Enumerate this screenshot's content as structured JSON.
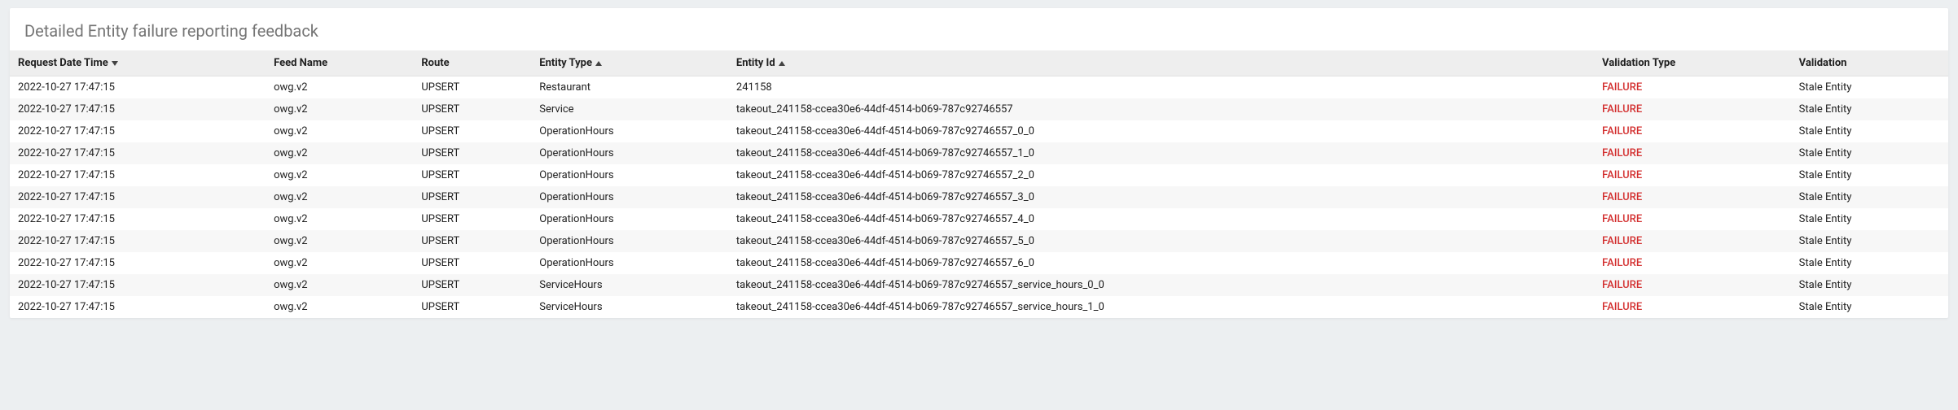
{
  "panel": {
    "title": "Detailed Entity failure reporting feedback"
  },
  "table": {
    "headers": {
      "request_dt": "Request Date Time",
      "feed_name": "Feed Name",
      "route": "Route",
      "entity_type": "Entity Type",
      "entity_id": "Entity Id",
      "validation_type": "Validation Type",
      "validation": "Validation"
    },
    "rows": [
      {
        "dt": "2022-10-27 17:47:15",
        "feed": "owg.v2",
        "route": "UPSERT",
        "etype": "Restaurant",
        "eid": "241158",
        "vtype": "FAILURE",
        "val": "Stale Entity"
      },
      {
        "dt": "2022-10-27 17:47:15",
        "feed": "owg.v2",
        "route": "UPSERT",
        "etype": "Service",
        "eid": "takeout_241158-ccea30e6-44df-4514-b069-787c92746557",
        "vtype": "FAILURE",
        "val": "Stale Entity"
      },
      {
        "dt": "2022-10-27 17:47:15",
        "feed": "owg.v2",
        "route": "UPSERT",
        "etype": "OperationHours",
        "eid": "takeout_241158-ccea30e6-44df-4514-b069-787c92746557_0_0",
        "vtype": "FAILURE",
        "val": "Stale Entity"
      },
      {
        "dt": "2022-10-27 17:47:15",
        "feed": "owg.v2",
        "route": "UPSERT",
        "etype": "OperationHours",
        "eid": "takeout_241158-ccea30e6-44df-4514-b069-787c92746557_1_0",
        "vtype": "FAILURE",
        "val": "Stale Entity"
      },
      {
        "dt": "2022-10-27 17:47:15",
        "feed": "owg.v2",
        "route": "UPSERT",
        "etype": "OperationHours",
        "eid": "takeout_241158-ccea30e6-44df-4514-b069-787c92746557_2_0",
        "vtype": "FAILURE",
        "val": "Stale Entity"
      },
      {
        "dt": "2022-10-27 17:47:15",
        "feed": "owg.v2",
        "route": "UPSERT",
        "etype": "OperationHours",
        "eid": "takeout_241158-ccea30e6-44df-4514-b069-787c92746557_3_0",
        "vtype": "FAILURE",
        "val": "Stale Entity"
      },
      {
        "dt": "2022-10-27 17:47:15",
        "feed": "owg.v2",
        "route": "UPSERT",
        "etype": "OperationHours",
        "eid": "takeout_241158-ccea30e6-44df-4514-b069-787c92746557_4_0",
        "vtype": "FAILURE",
        "val": "Stale Entity"
      },
      {
        "dt": "2022-10-27 17:47:15",
        "feed": "owg.v2",
        "route": "UPSERT",
        "etype": "OperationHours",
        "eid": "takeout_241158-ccea30e6-44df-4514-b069-787c92746557_5_0",
        "vtype": "FAILURE",
        "val": "Stale Entity"
      },
      {
        "dt": "2022-10-27 17:47:15",
        "feed": "owg.v2",
        "route": "UPSERT",
        "etype": "OperationHours",
        "eid": "takeout_241158-ccea30e6-44df-4514-b069-787c92746557_6_0",
        "vtype": "FAILURE",
        "val": "Stale Entity"
      },
      {
        "dt": "2022-10-27 17:47:15",
        "feed": "owg.v2",
        "route": "UPSERT",
        "etype": "ServiceHours",
        "eid": "takeout_241158-ccea30e6-44df-4514-b069-787c92746557_service_hours_0_0",
        "vtype": "FAILURE",
        "val": "Stale Entity"
      },
      {
        "dt": "2022-10-27 17:47:15",
        "feed": "owg.v2",
        "route": "UPSERT",
        "etype": "ServiceHours",
        "eid": "takeout_241158-ccea30e6-44df-4514-b069-787c92746557_service_hours_1_0",
        "vtype": "FAILURE",
        "val": "Stale Entity"
      }
    ]
  }
}
